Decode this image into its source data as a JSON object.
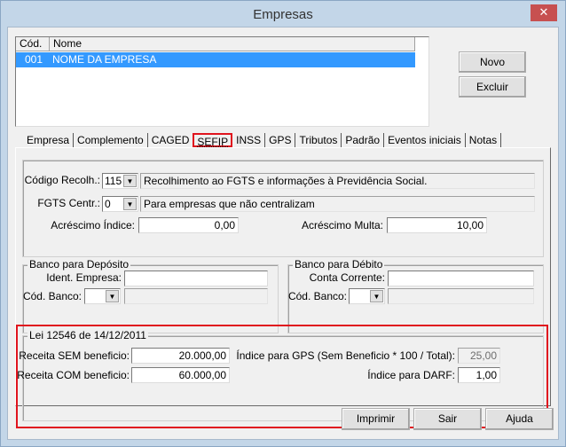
{
  "window": {
    "title": "Empresas",
    "close_icon": "close-icon"
  },
  "list": {
    "columns": [
      "Cód.",
      "Nome"
    ],
    "rows": [
      {
        "cod": "001",
        "nome": "NOME DA EMPRESA"
      }
    ]
  },
  "buttons": {
    "novo": "Novo",
    "excluir": "Excluir",
    "imprimir": "Imprimir",
    "sair": "Sair",
    "ajuda": "Ajuda"
  },
  "tabs": [
    "Empresa",
    "Complemento",
    "CAGED",
    "SEFIP",
    "INSS",
    "GPS",
    "Tributos",
    "Padrão",
    "Eventos iniciais",
    "Notas"
  ],
  "active_tab": "SEFIP",
  "sefip": {
    "codigo_recolh": {
      "label": "Código Recolh.:",
      "value": "115",
      "description": "Recolhimento ao FGTS e informações à Previdência Social."
    },
    "fgts_centr": {
      "label": "FGTS Centr.:",
      "value": "0",
      "description": "Para empresas que não centralizam"
    },
    "acrescimo_indice": {
      "label": "Acréscimo Índice:",
      "value": "0,00"
    },
    "acrescimo_multa": {
      "label": "Acréscimo Multa:",
      "value": "10,00"
    }
  },
  "banco_deposito": {
    "title": "Banco para Depósito",
    "ident_label": "Ident. Empresa:",
    "ident_value": "",
    "cod_label": "Cód. Banco:",
    "cod_value": "",
    "cod_desc": ""
  },
  "banco_debito": {
    "title": "Banco para Débito",
    "conta_label": "Conta Corrente:",
    "conta_value": "",
    "cod_label": "Cód. Banco:",
    "cod_value": "",
    "cod_desc": ""
  },
  "lei": {
    "title": "Lei 12546 de 14/12/2011",
    "sem_label": "Receita SEM beneficio:",
    "sem_value": "20.000,00",
    "com_label": "Receita COM beneficio:",
    "com_value": "60.000,00",
    "gps_label": "Índice para GPS (Sem Beneficio * 100 / Total):",
    "gps_value": "25,00",
    "darf_label": "Índice para DARF:",
    "darf_value": "1,00"
  },
  "colors": {
    "selection": "#3399ff",
    "highlight": "#e0141e",
    "close": "#c75050"
  }
}
